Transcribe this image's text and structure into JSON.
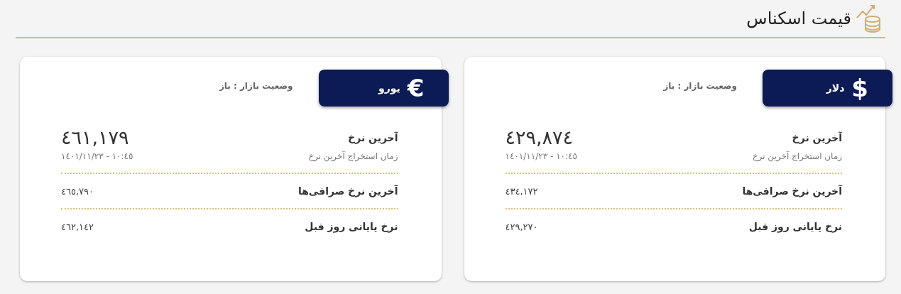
{
  "header": {
    "title": "قیمت اسکناس"
  },
  "cards": [
    {
      "currency": "دلار",
      "symbol": "$",
      "market_status": "وضعیت بازار : باز",
      "last_rate_label": "آخرین نرخ",
      "last_rate": "٤٢٩,٨٧٤",
      "time_label": "زمان استخراج آخرین نرخ",
      "time": "١٠:٤٥ - ١٤٠١/١١/٢٣",
      "rows": [
        {
          "label": "آخرین نرخ صرافی‌ها",
          "value": "٤٣٤,١٧٢"
        },
        {
          "label": "نرخ پایانی روز قبل",
          "value": "٤٢٩,٢٧٠"
        }
      ]
    },
    {
      "currency": "یورو",
      "symbol": "€",
      "market_status": "وضعیت بازار : باز",
      "last_rate_label": "آخرین نرخ",
      "last_rate": "٤٦١,١٧٩",
      "time_label": "زمان استخراج آخرین نرخ",
      "time": "١٠:٤٥ - ١٤٠١/١١/٢٣",
      "rows": [
        {
          "label": "آخرین نرخ صرافی‌ها",
          "value": "٤٦٥,٧٩٠"
        },
        {
          "label": "نرخ پایانی روز قبل",
          "value": "٤٦٢,١٤٢"
        }
      ]
    }
  ]
}
